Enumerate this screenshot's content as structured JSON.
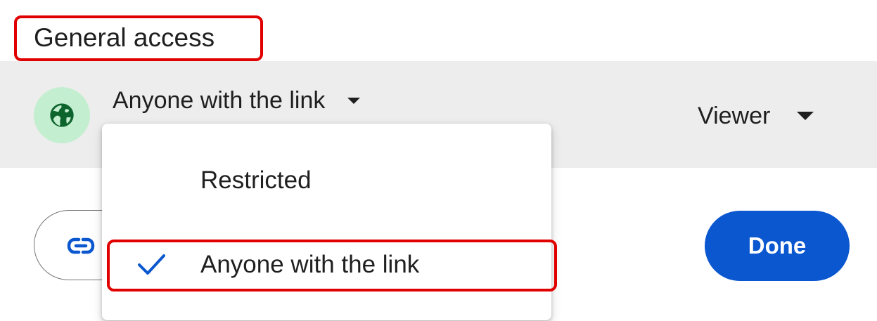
{
  "section": {
    "title": "General access"
  },
  "access": {
    "selected": "Anyone with the link",
    "role": "Viewer",
    "icon": "globe-icon",
    "icon_bg_color": "#c4eed0",
    "icon_color": "#0d652d"
  },
  "menu": {
    "items": [
      {
        "label": "Restricted",
        "selected": false
      },
      {
        "label": "Anyone with the link",
        "selected": true
      }
    ],
    "check_icon": "check-icon",
    "check_color": "#0b57d0"
  },
  "buttons": {
    "copy_link_icon": "link-icon",
    "done_label": "Done",
    "done_color": "#0b57d0"
  },
  "highlight_color": "#e00000"
}
